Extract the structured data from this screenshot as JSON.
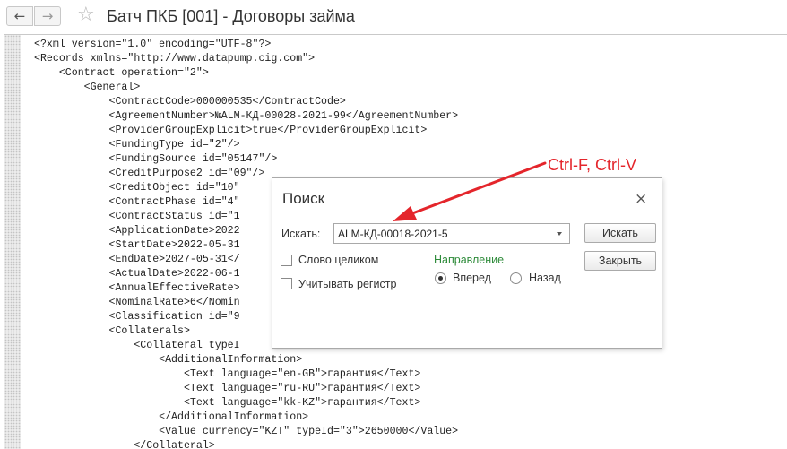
{
  "window": {
    "title": "Батч ПКБ [001] - Договоры займа",
    "back_glyph": "←",
    "forward_glyph": "→",
    "favorite_glyph": "☆",
    "icons": [
      "arrow-left-icon",
      "arrow-right-icon",
      "star-icon"
    ]
  },
  "editor": {
    "lines": [
      "<?xml version=\"1.0\" encoding=\"UTF-8\"?>",
      "<Records xmlns=\"http://www.datapump.cig.com\">",
      "    <Contract operation=\"2\">",
      "        <General>",
      "            <ContractCode>000000535</ContractCode>",
      "            <AgreementNumber>№ALM-КД-00028-2021-99</AgreementNumber>",
      "            <ProviderGroupExplicit>true</ProviderGroupExplicit>",
      "            <FundingType id=\"2\"/>",
      "            <FundingSource id=\"05147\"/>",
      "            <CreditPurpose2 id=\"09\"/>",
      "            <CreditObject id=\"10\"",
      "            <ContractPhase id=\"4\"",
      "            <ContractStatus id=\"1",
      "            <ApplicationDate>2022",
      "            <StartDate>2022-05-31",
      "            <EndDate>2027-05-31</",
      "            <ActualDate>2022-06-1",
      "            <AnnualEffectiveRate>",
      "            <NominalRate>6</Nomin",
      "            <Classification id=\"9",
      "            <Collaterals>",
      "                <Collateral typeI",
      "                    <AdditionalInformation>",
      "                        <Text language=\"en-GB\">гарантия</Text>",
      "                        <Text language=\"ru-RU\">гарантия</Text>",
      "                        <Text language=\"kk-KZ\">гарантия</Text>",
      "                    </AdditionalInformation>",
      "                    <Value currency=\"KZT\" typeId=\"3\">2650000</Value>",
      "                </Collateral>"
    ]
  },
  "dialog": {
    "title": "Поиск",
    "close_glyph": "×",
    "search_label": "Искать:",
    "search_value": "ALM-КД-00018-2021-5",
    "find_button": "Искать",
    "close_button": "Закрыть",
    "whole_word_label": "Слово целиком",
    "whole_word_checked": false,
    "match_case_label": "Учитывать регистр",
    "match_case_checked": false,
    "direction_label": "Направление",
    "forward_label": "Вперед",
    "back_label": "Назад",
    "direction_selected": "Вперед",
    "direction_color": "#2e8b3a"
  },
  "annotation": {
    "text": "Ctrl-F, Ctrl-V",
    "color": "#e4252b"
  }
}
